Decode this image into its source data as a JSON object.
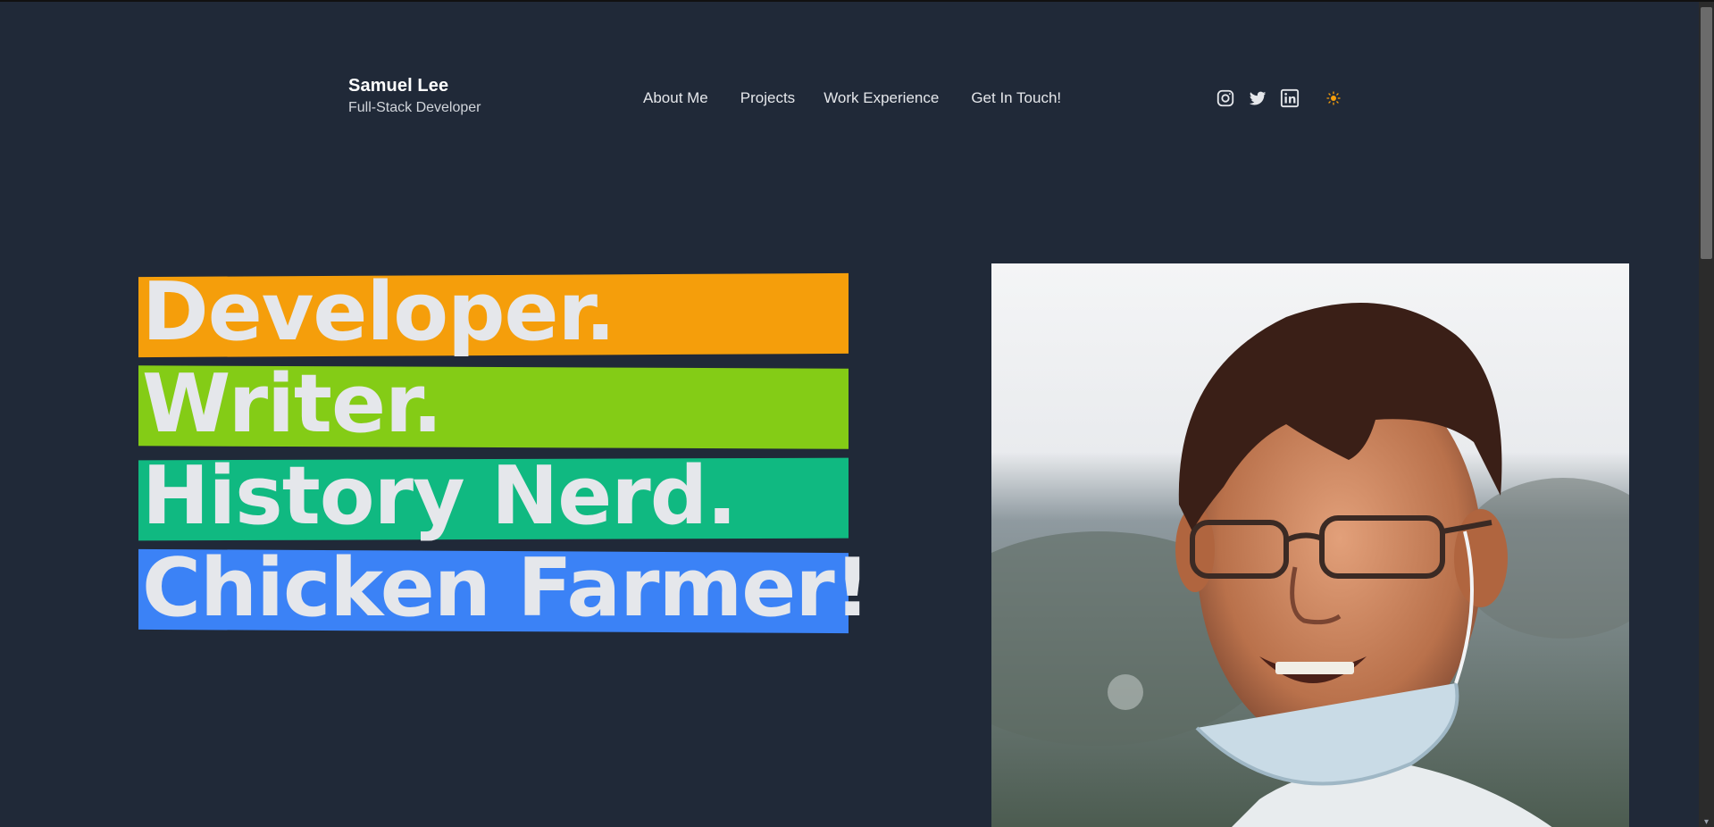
{
  "header": {
    "name": "Samuel Lee",
    "role": "Full-Stack Developer",
    "nav": [
      {
        "label": "About Me"
      },
      {
        "label": "Projects"
      },
      {
        "label": "Work Experience"
      },
      {
        "label": "Get In Touch!"
      }
    ],
    "socials": [
      {
        "icon": "instagram-icon"
      },
      {
        "icon": "twitter-icon"
      },
      {
        "icon": "linkedin-icon"
      }
    ],
    "theme_icon": "sun-icon"
  },
  "hero": {
    "lines": [
      {
        "text": "Developer.",
        "color": "#f59e0b"
      },
      {
        "text": "Writer.",
        "color": "#84cc16"
      },
      {
        "text": "History Nerd.",
        "color": "#10b981"
      },
      {
        "text": "Chicken Farmer!",
        "color": "#3b82f6"
      }
    ]
  },
  "colors": {
    "background": "#202938",
    "text": "#e5e7eb",
    "accent_sun": "#f59e0b"
  }
}
